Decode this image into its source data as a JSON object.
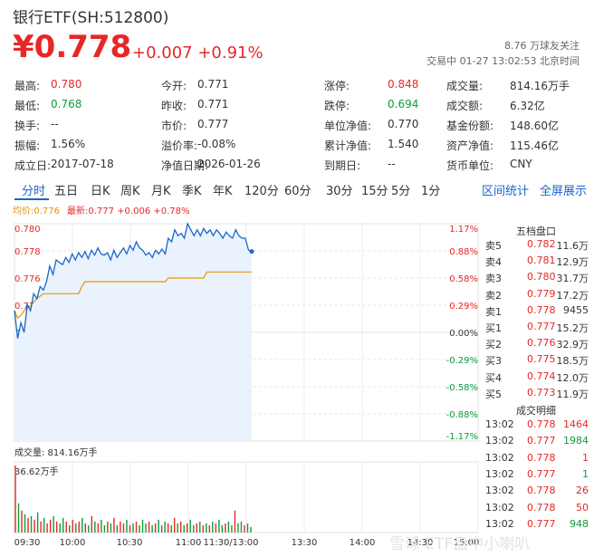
{
  "header": {
    "title": "银行ETF(SH:512800)",
    "price": "¥0.778",
    "change": "+0.007 +0.91%",
    "followers": "8.76 万球友关注",
    "trade_status": "交易中 01-27 13:02:53 北京时间"
  },
  "info": {
    "rows": [
      [
        {
          "label": "最高:",
          "value": "0.780",
          "color": "red"
        },
        {
          "label": "今开:",
          "value": "0.771",
          "color": "normal"
        },
        {
          "label": "涨停:",
          "value": "0.848",
          "color": "red"
        },
        {
          "label": "成交量:",
          "value": "814.16万手",
          "color": "normal"
        }
      ],
      [
        {
          "label": "最低:",
          "value": "0.768",
          "color": "green"
        },
        {
          "label": "昨收:",
          "value": "0.771",
          "color": "normal"
        },
        {
          "label": "跌停:",
          "value": "0.694",
          "color": "green"
        },
        {
          "label": "成交额:",
          "value": "6.32亿",
          "color": "normal"
        }
      ],
      [
        {
          "label": "换手:",
          "value": "--",
          "color": "normal"
        },
        {
          "label": "市价:",
          "value": "0.777",
          "color": "normal"
        },
        {
          "label": "单位净值:",
          "value": "0.770",
          "color": "normal"
        },
        {
          "label": "基金份额:",
          "value": "148.60亿",
          "color": "normal"
        }
      ],
      [
        {
          "label": "振幅:",
          "value": "1.56%",
          "color": "normal"
        },
        {
          "label": "溢价率:",
          "value": "-0.08%",
          "color": "normal"
        },
        {
          "label": "累计净值:",
          "value": "1.540",
          "color": "normal"
        },
        {
          "label": "资产净值:",
          "value": "115.46亿",
          "color": "normal"
        }
      ],
      [
        {
          "label": "成立日:",
          "value": "2017-07-18",
          "color": "normal"
        },
        {
          "label": "净值日期:",
          "value": "2026-01-26",
          "color": "normal"
        },
        {
          "label": "到期日:",
          "value": "--",
          "color": "normal"
        },
        {
          "label": "货币单位:",
          "value": "CNY",
          "color": "normal"
        }
      ]
    ]
  },
  "tabs": {
    "items": [
      "分时",
      "五日",
      "日K",
      "周K",
      "月K",
      "季K",
      "年K",
      "120分",
      "60分",
      "30分",
      "15分",
      "5分",
      "1分"
    ],
    "active": "分时",
    "right_items": [
      "区间统计",
      "全屏展示"
    ]
  },
  "legend": {
    "avg": "均价:0.776",
    "last": "最新:0.777 +0.006 +0.78%"
  },
  "colors": {
    "up": "#e62727",
    "down": "#0e9b3a",
    "price_line": "#1a66c9",
    "avg_line": "#e69500",
    "fill": "#eaf3fd"
  },
  "chart_data": {
    "type": "line",
    "x": [
      "09:30",
      "10:00",
      "10:30",
      "11:00",
      "11:30/13:00",
      "13:30",
      "14:00",
      "14:30",
      "15:00"
    ],
    "ylim": [
      0.762,
      0.78
    ],
    "y_ticks_left": [
      "0.780",
      "0.778",
      "0.776",
      "0.773",
      "0.771",
      "0.769",
      "0.766",
      "0.764",
      "0.762"
    ],
    "y_ticks_right": [
      "1.17%",
      "0.88%",
      "0.58%",
      "0.29%",
      "0.00%",
      "-0.29%",
      "-0.58%",
      "-0.88%",
      "-1.17%"
    ],
    "prev_close": 0.771,
    "series": [
      {
        "values": [
          0.7728,
          0.7705,
          0.7718,
          0.771,
          0.7733,
          0.7728,
          0.7742,
          0.7738,
          0.7748,
          0.7745,
          0.7752,
          0.7765,
          0.7758,
          0.777,
          0.7768,
          0.7766,
          0.7772,
          0.7768,
          0.7775,
          0.777,
          0.7776,
          0.7772,
          0.7777,
          0.7771,
          0.7778,
          0.7774,
          0.778,
          0.7775,
          0.7774,
          0.7776,
          0.777,
          0.7778,
          0.7772,
          0.7776,
          0.778,
          0.7775,
          0.7782,
          0.7778,
          0.7785,
          0.778,
          0.7778,
          0.7774,
          0.7776,
          0.7772,
          0.7778,
          0.7775,
          0.7779,
          0.7775,
          0.7788,
          0.7785,
          0.7795,
          0.779,
          0.7792,
          0.7788,
          0.78,
          0.7795,
          0.779,
          0.7795,
          0.779,
          0.7796,
          0.7792,
          0.7795,
          0.779,
          0.7795,
          0.7792,
          0.7788,
          0.7793,
          0.779,
          0.7788,
          0.7795,
          0.779,
          0.7788,
          0.7788,
          0.7778,
          0.7777
        ]
      },
      {
        "values": [
          0.7728,
          0.7722,
          0.7724,
          0.7728,
          0.773,
          0.7732,
          0.7735,
          0.7738,
          0.774,
          0.7742,
          0.7742,
          0.7742,
          0.7742,
          0.7742,
          0.7742,
          0.7742,
          0.7742,
          0.7742,
          0.7742,
          0.7742,
          0.7742,
          0.7748,
          0.7752,
          0.7752,
          0.7752,
          0.7752,
          0.7752,
          0.7752,
          0.7752,
          0.7752,
          0.7752,
          0.7752,
          0.7752,
          0.7752,
          0.7752,
          0.7752,
          0.7752,
          0.7752,
          0.7752,
          0.7752,
          0.7752,
          0.7752,
          0.7752,
          0.7752,
          0.7752,
          0.7752,
          0.7752,
          0.7752,
          0.7755,
          0.7755,
          0.7755,
          0.7755,
          0.7755,
          0.7755,
          0.7755,
          0.7755,
          0.7755,
          0.7755,
          0.7755,
          0.7755,
          0.776,
          0.776,
          0.776,
          0.776,
          0.776,
          0.776,
          0.776,
          0.776,
          0.776,
          0.776,
          0.776,
          0.776,
          0.776,
          0.776,
          0.776
        ]
      }
    ],
    "volume_label": "成交量: 814.16万手",
    "volume_max_label": "36.62万手",
    "volume_max": 36.62,
    "volume": [
      36.6,
      16,
      12,
      10,
      8,
      9,
      7,
      11,
      6,
      8,
      5,
      7,
      9,
      6,
      5,
      8,
      6,
      4,
      7,
      5,
      6,
      8,
      5,
      4,
      9,
      6,
      5,
      7,
      4,
      6,
      5,
      8,
      4,
      6,
      5,
      7,
      4,
      5,
      6,
      4,
      7,
      5,
      6,
      4,
      5,
      7,
      4,
      6,
      5,
      4,
      8,
      5,
      6,
      4,
      5,
      7,
      4,
      5,
      6,
      4,
      5,
      4,
      6,
      5,
      7,
      4,
      5,
      6,
      4,
      12,
      5,
      6,
      4,
      5,
      3
    ]
  },
  "order_book": {
    "title": "五档盘口",
    "rows": [
      {
        "label": "卖5",
        "price": "0.782",
        "qty": "11.6万",
        "color": "red"
      },
      {
        "label": "卖4",
        "price": "0.781",
        "qty": "12.9万",
        "color": "red"
      },
      {
        "label": "卖3",
        "price": "0.780",
        "qty": "31.7万",
        "color": "red"
      },
      {
        "label": "卖2",
        "price": "0.779",
        "qty": "17.2万",
        "color": "red"
      },
      {
        "label": "卖1",
        "price": "0.778",
        "qty": "9455",
        "color": "red"
      },
      {
        "label": "买1",
        "price": "0.777",
        "qty": "15.2万",
        "color": "red"
      },
      {
        "label": "买2",
        "price": "0.776",
        "qty": "32.9万",
        "color": "red"
      },
      {
        "label": "买3",
        "price": "0.775",
        "qty": "18.5万",
        "color": "red"
      },
      {
        "label": "买4",
        "price": "0.774",
        "qty": "12.0万",
        "color": "red"
      },
      {
        "label": "买5",
        "price": "0.773",
        "qty": "11.9万",
        "color": "red"
      }
    ]
  },
  "deals": {
    "title": "成交明细",
    "rows": [
      {
        "time": "13:02",
        "price": "0.778",
        "qty": "1464",
        "qty_color": "red"
      },
      {
        "time": "13:02",
        "price": "0.777",
        "qty": "1984",
        "qty_color": "green"
      },
      {
        "time": "13:02",
        "price": "0.778",
        "qty": "1",
        "qty_color": "red"
      },
      {
        "time": "13:02",
        "price": "0.777",
        "qty": "1",
        "qty_color": "green"
      },
      {
        "time": "13:02",
        "price": "0.778",
        "qty": "26",
        "qty_color": "red"
      },
      {
        "time": "13:02",
        "price": "0.778",
        "qty": "50",
        "qty_color": "red"
      },
      {
        "time": "13:02",
        "price": "0.777",
        "qty": "948",
        "qty_color": "green"
      }
    ]
  },
  "watermark": "雪球 ETF盘中小喇叭"
}
